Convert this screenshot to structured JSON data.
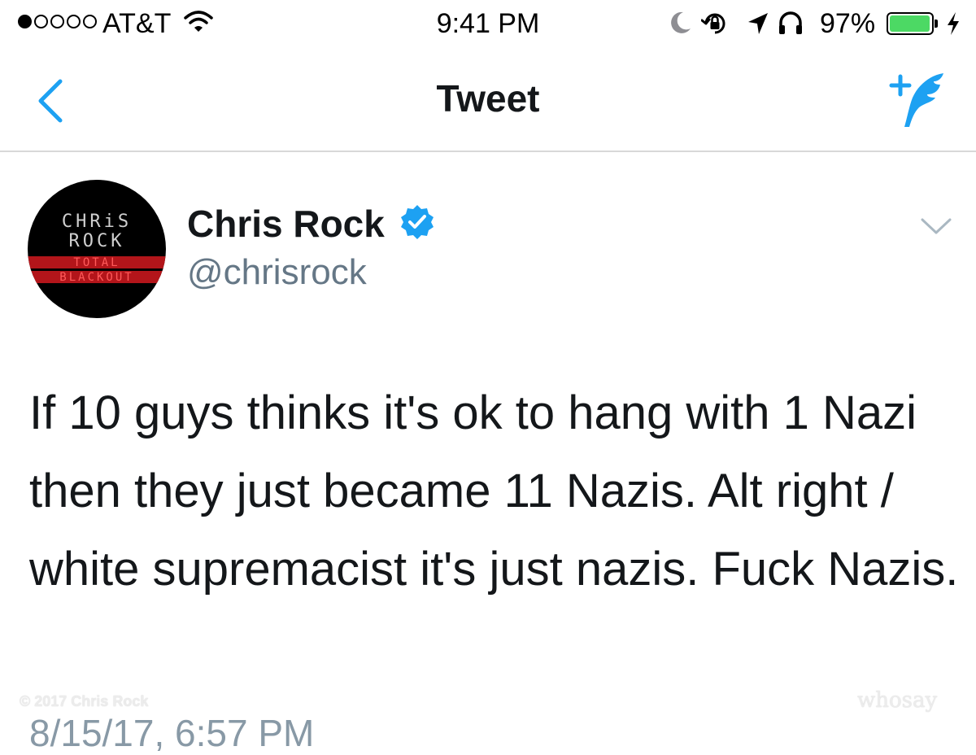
{
  "status_bar": {
    "carrier": "AT&T",
    "time": "9:41 PM",
    "battery_percent": "97%",
    "battery_level": 0.97,
    "signal_bars_filled": 1,
    "signal_bars_total": 5,
    "icons": [
      "wifi-icon",
      "moon-icon",
      "rotation-lock-icon",
      "location-arrow-icon",
      "headphones-icon",
      "charging-bolt-icon"
    ]
  },
  "nav": {
    "title": "Tweet",
    "back_icon": "chevron-left-icon",
    "compose_icon": "compose-quill-icon"
  },
  "tweet": {
    "author": {
      "display_name": "Chris Rock",
      "handle": "@chrisrock",
      "verified": true,
      "avatar_text": {
        "line1": "CHRiS",
        "line2": "ROCK",
        "line3": "TOTAL",
        "line4": "BLACKOUT"
      }
    },
    "text": "If 10 guys thinks it's ok to hang with 1 Nazi then they just became 11 Nazis. Alt right / white supremacist it's just nazis. Fuck Nazis.",
    "timestamp": "8/15/17, 6:57 PM"
  },
  "watermarks": {
    "copyright": "© 2017 Chris Rock",
    "logo": "whosay"
  },
  "colors": {
    "accent": "#1da1f2",
    "battery_green": "#4cd964",
    "handle_gray": "#657786",
    "divider": "#d8d8d8",
    "avatar_red": "#b3151a"
  }
}
